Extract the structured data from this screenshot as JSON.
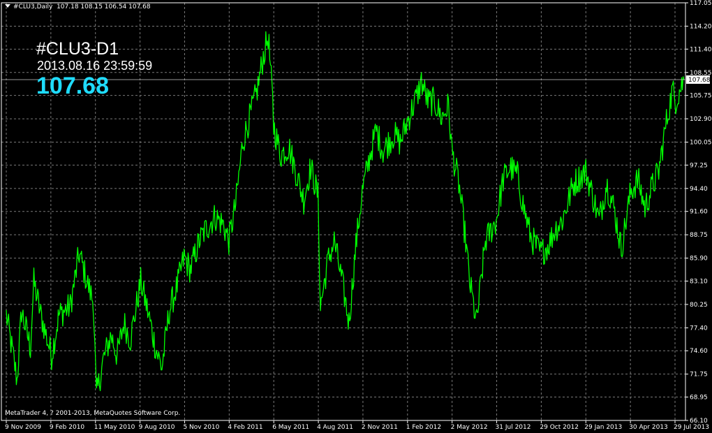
{
  "header": {
    "symbol_tf": "#CLU3,Daily",
    "ohlc": "107.18 108.15 106.54 107.68"
  },
  "overlay": {
    "symbol": "#CLU3-D1",
    "datetime": "2013.08.16 23:59:59",
    "price": "107.68"
  },
  "footer": {
    "copyright": "MetaTrader 4, ? 2001-2013, MetaQuotes Software Corp."
  },
  "colors": {
    "background": "#000000",
    "grid": "#7a7a7a",
    "series": "#00ff00",
    "price_text": "#1fdcff",
    "axis": "#ffffff"
  },
  "chart_data": {
    "type": "line",
    "title": "",
    "xlabel": "",
    "ylabel": "",
    "grid": true,
    "ylim": [
      66.1,
      117.05
    ],
    "y_ticks": [
      "117.05",
      "114.20",
      "111.40",
      "108.55",
      "105.75",
      "102.90",
      "100.05",
      "97.25",
      "94.40",
      "91.60",
      "88.75",
      "85.90",
      "83.10",
      "80.25",
      "77.40",
      "74.60",
      "71.75",
      "68.95",
      "66.10"
    ],
    "x_ticks": [
      "9 Nov 2009",
      "9 Feb 2010",
      "11 May 2010",
      "9 Aug 2010",
      "5 Nov 2010",
      "4 Feb 2011",
      "6 May 2011",
      "4 Aug 2011",
      "2 Nov 2011",
      "1 Feb 2012",
      "2 May 2012",
      "31 Jul 2012",
      "29 Oct 2012",
      "29 Jan 2013",
      "30 Apr 2013",
      "29 Jul 2013"
    ],
    "last_price": 107.68,
    "series": [
      {
        "x": [
          "2009-11-09",
          "2009-12-01",
          "2009-12-10",
          "2009-12-28",
          "2010-01-04",
          "2010-01-18",
          "2010-02-09",
          "2010-02-24",
          "2010-03-19",
          "2010-04-06",
          "2010-04-22",
          "2010-05-05",
          "2010-05-11",
          "2010-05-25",
          "2010-06-10",
          "2010-06-22",
          "2010-07-06",
          "2010-07-19",
          "2010-08-09",
          "2010-08-25",
          "2010-09-08",
          "2010-09-21",
          "2010-10-06",
          "2010-10-22",
          "2010-11-05",
          "2010-11-18",
          "2010-12-06",
          "2010-12-20",
          "2011-01-07",
          "2011-01-24",
          "2011-02-04",
          "2011-02-18",
          "2011-03-04",
          "2011-03-18",
          "2011-04-01",
          "2011-04-15",
          "2011-04-25",
          "2011-05-04",
          "2011-05-06",
          "2011-05-20",
          "2011-06-06",
          "2011-06-20",
          "2011-07-06",
          "2011-07-20",
          "2011-08-04",
          "2011-08-09",
          "2011-08-24",
          "2011-09-06",
          "2011-09-22",
          "2011-10-06",
          "2011-10-20",
          "2011-11-02",
          "2011-11-16",
          "2011-11-30",
          "2011-12-14",
          "2012-01-05",
          "2012-01-18",
          "2012-02-01",
          "2012-02-23",
          "2012-03-01",
          "2012-03-14",
          "2012-03-28",
          "2012-04-11",
          "2012-04-25",
          "2012-05-02",
          "2012-05-16",
          "2012-05-30",
          "2012-06-07",
          "2012-06-21",
          "2012-07-09",
          "2012-07-31",
          "2012-08-14",
          "2012-08-28",
          "2012-09-12",
          "2012-09-25",
          "2012-10-09",
          "2012-10-29",
          "2012-11-14",
          "2012-11-28",
          "2012-12-12",
          "2013-01-04",
          "2013-01-29",
          "2013-02-12",
          "2013-02-25",
          "2013-03-12",
          "2013-03-27",
          "2013-04-11",
          "2013-04-30",
          "2013-05-15",
          "2013-05-29",
          "2013-06-12",
          "2013-06-26",
          "2013-07-10",
          "2013-07-24",
          "2013-07-29",
          "2013-08-16"
        ],
        "values": [
          79.0,
          71.0,
          79.5,
          75.0,
          83.0,
          79.0,
          74.0,
          79.0,
          80.0,
          86.5,
          83.0,
          80.5,
          69.0,
          73.5,
          76.5,
          74.0,
          78.0,
          76.0,
          83.0,
          79.0,
          75.0,
          72.5,
          79.5,
          82.5,
          86.0,
          84.5,
          88.0,
          89.5,
          91.0,
          90.0,
          88.0,
          92.5,
          100.0,
          103.0,
          106.0,
          110.5,
          113.0,
          105.0,
          102.0,
          98.5,
          99.5,
          96.5,
          93.0,
          97.0,
          93.5,
          80.0,
          85.5,
          88.0,
          83.0,
          78.0,
          87.5,
          94.0,
          98.0,
          101.5,
          99.0,
          101.0,
          100.0,
          102.5,
          106.0,
          107.5,
          105.0,
          105.0,
          103.0,
          104.5,
          99.0,
          95.0,
          88.0,
          83.0,
          78.0,
          88.0,
          90.5,
          95.5,
          97.0,
          96.0,
          92.0,
          88.5,
          86.5,
          87.5,
          89.5,
          90.5,
          95.0,
          96.5,
          93.5,
          90.5,
          95.0,
          92.0,
          87.0,
          94.0,
          95.5,
          92.0,
          94.5,
          96.5,
          102.0,
          106.5,
          105.0,
          107.68
        ]
      }
    ]
  }
}
